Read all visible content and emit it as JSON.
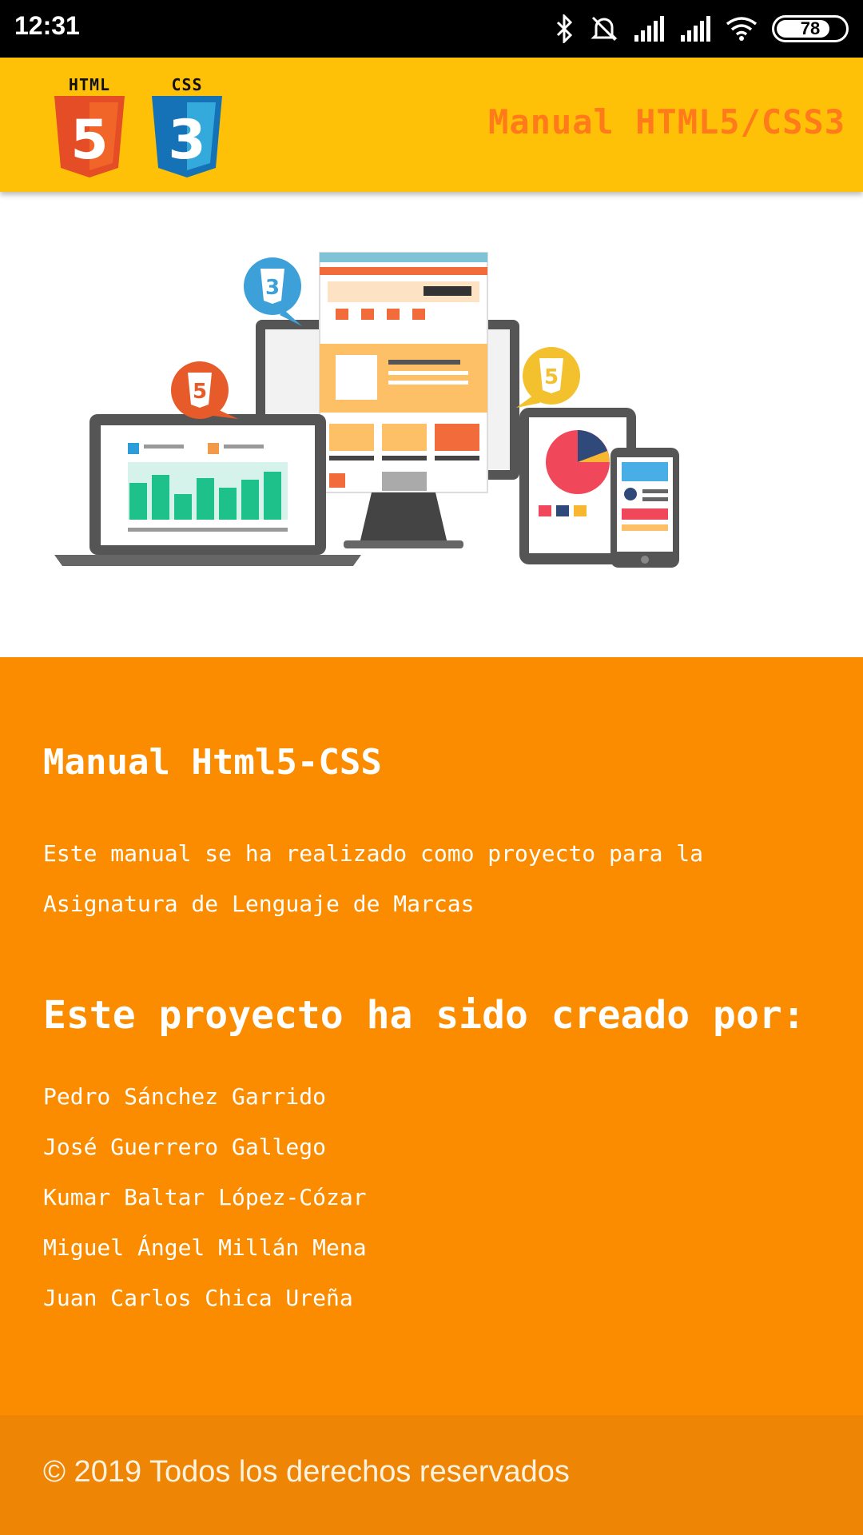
{
  "status_bar": {
    "time": "12:31",
    "battery": "78",
    "battery_level": 0.78,
    "icons": [
      "bluetooth-icon",
      "alarm-off-icon",
      "signal-icon",
      "signal-icon",
      "wifi-icon",
      "battery-icon"
    ]
  },
  "header": {
    "logos": [
      {
        "caption": "HTML",
        "number": "5",
        "color": "#e44d26"
      },
      {
        "caption": "CSS",
        "number": "3",
        "color": "#2965f1"
      }
    ],
    "title": "Manual HTML5/CSS3"
  },
  "hero": {
    "icons": [
      "css3-badge-icon",
      "html5-badge-icon",
      "html5-badge-icon"
    ]
  },
  "content": {
    "title": "Manual Html5-CSS",
    "description_line1": "Este manual se ha realizado como proyecto para la",
    "description_line2": "Asignatura de Lenguaje de Marcas",
    "subtitle": "Este proyecto ha sido creado por:",
    "authors": [
      "Pedro Sánchez Garrido",
      "José Guerrero Gallego",
      "Kumar Baltar López-Cózar",
      "Miguel Ángel Millán Mena",
      "Juan Carlos Chica Ureña"
    ]
  },
  "footer": {
    "text": "© 2019 Todos los derechos reservados"
  },
  "colors": {
    "header_bg": "#ffc107",
    "header_title": "#ff7a1a",
    "content_bg": "#fb8c00",
    "footer_bg": "#ef8505"
  }
}
